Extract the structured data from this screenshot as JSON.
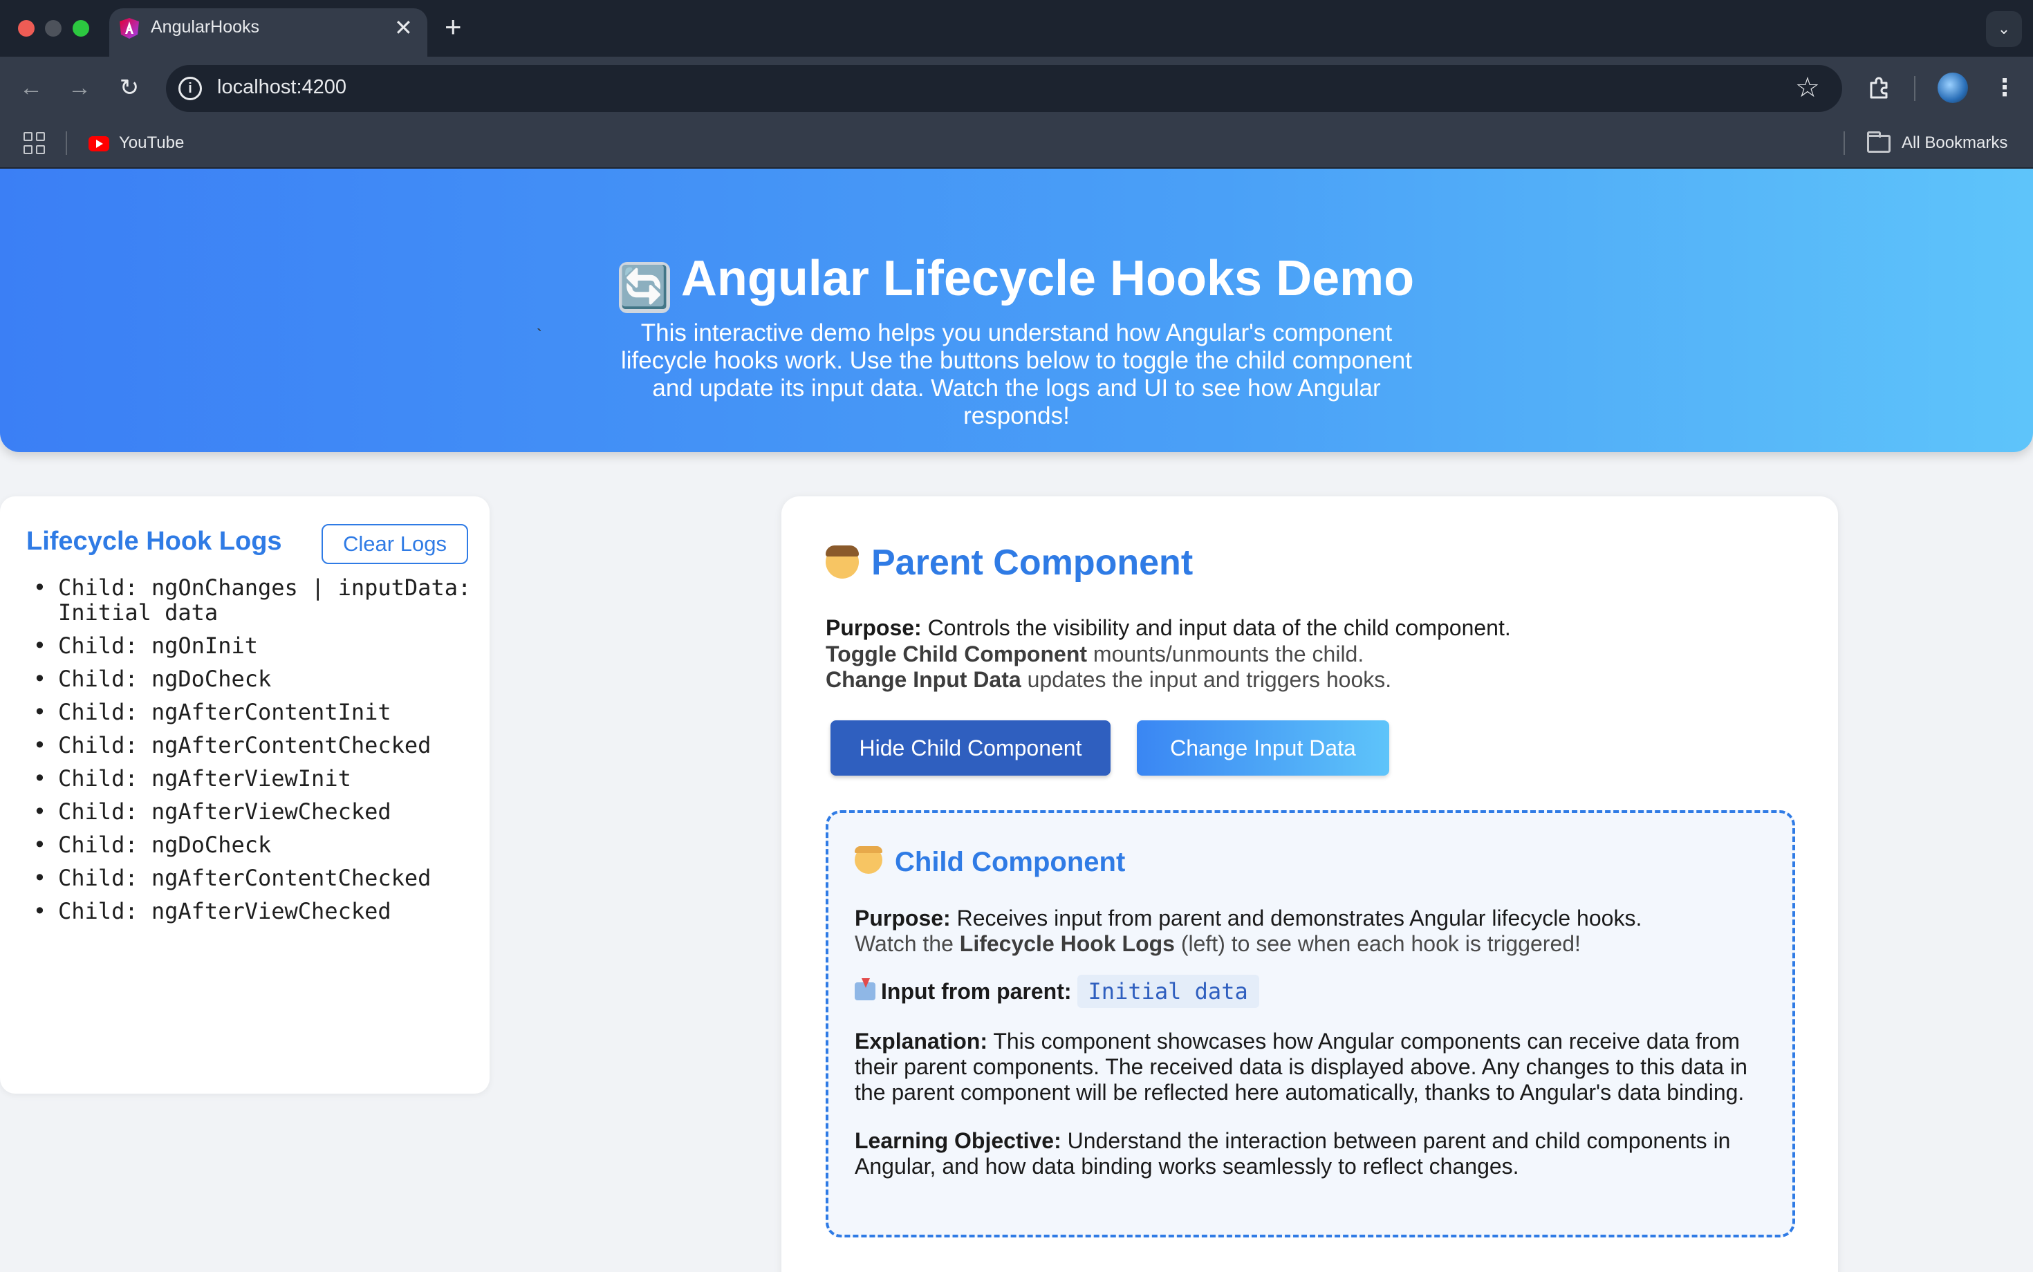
{
  "browser": {
    "tab_title": "AngularHooks",
    "url": "localhost:4200",
    "bookmarks": [
      {
        "label": "YouTube"
      }
    ],
    "all_bookmarks_label": "All Bookmarks"
  },
  "hero": {
    "emoji": "🔄",
    "title": "Angular Lifecycle Hooks Demo",
    "description": "This interactive demo helps you understand how Angular's component lifecycle hooks work. Use the buttons below to toggle the child component and update its input data. Watch the logs and UI to see how Angular responds!"
  },
  "stray_char": "`",
  "logs": {
    "title": "Lifecycle Hook Logs",
    "clear_label": "Clear Logs",
    "entries": [
      "Child: ngOnChanges | inputData: Initial data",
      "Child: ngOnInit",
      "Child: ngDoCheck",
      "Child: ngAfterContentInit",
      "Child: ngAfterContentChecked",
      "Child: ngAfterViewInit",
      "Child: ngAfterViewChecked",
      "Child: ngDoCheck",
      "Child: ngAfterContentChecked",
      "Child: ngAfterViewChecked"
    ]
  },
  "parent": {
    "title": "Parent Component",
    "purpose_label": "Purpose:",
    "purpose_text": "Controls the visibility and input data of the child component.",
    "toggle_label": "Toggle Child Component",
    "toggle_text": "mounts/unmounts the child.",
    "change_label": "Change Input Data",
    "change_text": "updates the input and triggers hooks.",
    "hide_button": "Hide Child Component",
    "change_button": "Change Input Data"
  },
  "child": {
    "title": "Child Component",
    "purpose_label": "Purpose:",
    "purpose_text": "Receives input from parent and demonstrates Angular lifecycle hooks.",
    "watch_pre": "Watch the",
    "watch_bold": "Lifecycle Hook Logs",
    "watch_post": "(left) to see when each hook is triggered!",
    "input_label": "Input from parent:",
    "input_value": "Initial data",
    "explanation_label": "Explanation:",
    "explanation_text": "This component showcases how Angular components can receive data from their parent components. The received data is displayed above. Any changes to this data in the parent component will be reflected here automatically, thanks to Angular's data binding.",
    "objective_label": "Learning Objective:",
    "objective_text": "Understand the interaction between parent and child components in Angular, and how data binding works seamlessly to reflect changes."
  }
}
